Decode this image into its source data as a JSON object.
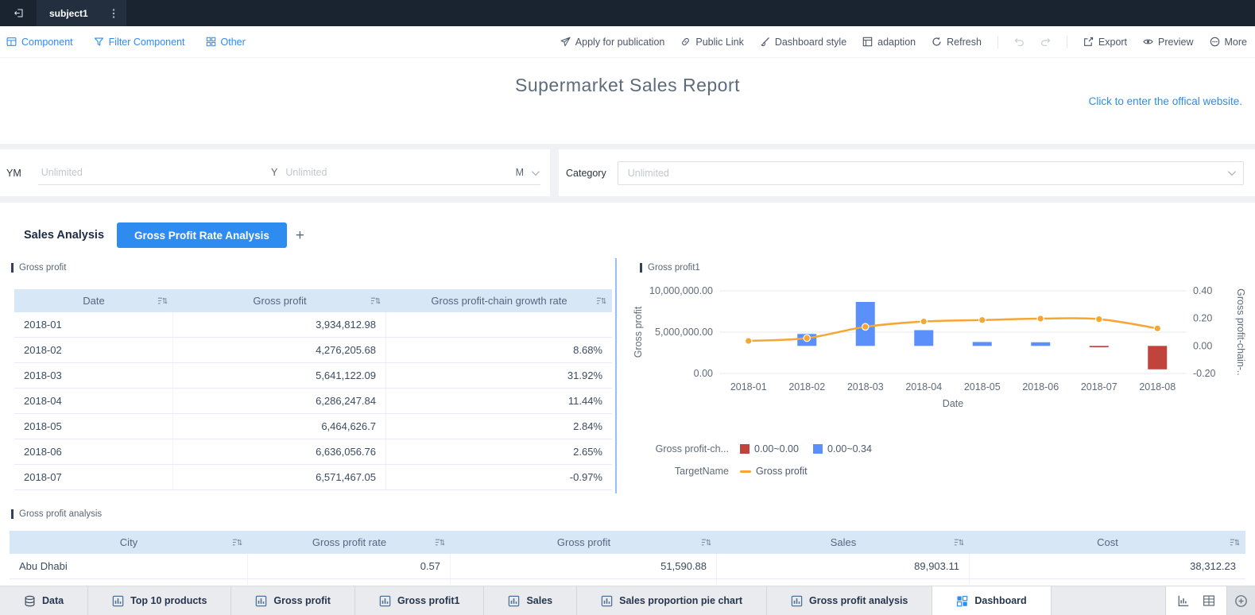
{
  "colors": {
    "accent": "#2e8cf0",
    "bar_positive": "#5b8ff9",
    "bar_negative": "#c0443c",
    "line": "#f6a632",
    "table_header_bg": "#d8e7f6",
    "topbar_bg": "#1a2330"
  },
  "topbar": {
    "tab_title": "subject1"
  },
  "toolbar": {
    "left": [
      {
        "label": "Component",
        "icon": "component"
      },
      {
        "label": "Filter Component",
        "icon": "filter"
      },
      {
        "label": "Other",
        "icon": "other"
      }
    ],
    "right": [
      {
        "type": "button",
        "label": "Apply for publication",
        "icon": "plane"
      },
      {
        "type": "button",
        "label": "Public Link",
        "icon": "link"
      },
      {
        "type": "button",
        "label": "Dashboard style",
        "icon": "style"
      },
      {
        "type": "button",
        "label": "adaption",
        "icon": "adaption"
      },
      {
        "type": "button",
        "label": "Refresh",
        "icon": "refresh"
      },
      {
        "type": "separator"
      },
      {
        "type": "icon",
        "icon": "undo",
        "disabled": true
      },
      {
        "type": "icon",
        "icon": "redo",
        "disabled": true
      },
      {
        "type": "separator"
      },
      {
        "type": "button",
        "label": "Export",
        "icon": "export"
      },
      {
        "type": "button",
        "label": "Preview",
        "icon": "preview"
      },
      {
        "type": "button",
        "label": "More",
        "icon": "more"
      }
    ]
  },
  "header": {
    "title": "Supermarket Sales Report",
    "link": "Click to enter the offical website."
  },
  "filters": {
    "ym": {
      "label": "YM",
      "start_placeholder": "Unlimited",
      "start_unit": "Y",
      "end_placeholder": "Unlimited",
      "end_unit": "M"
    },
    "category": {
      "label": "Category",
      "placeholder": "Unlimited"
    }
  },
  "tabs": {
    "inactive": "Sales Analysis",
    "active": "Gross Profit Rate Analysis",
    "add_label": "+"
  },
  "gross_profit_table": {
    "title": "Gross profit",
    "columns": [
      "Date",
      "Gross profit",
      "Gross profit-chain growth rate"
    ],
    "rows": [
      [
        "2018-01",
        "3,934,812.98",
        ""
      ],
      [
        "2018-02",
        "4,276,205.68",
        "8.68%"
      ],
      [
        "2018-03",
        "5,641,122.09",
        "31.92%"
      ],
      [
        "2018-04",
        "6,286,247.84",
        "11.44%"
      ],
      [
        "2018-05",
        "6,464,626.7",
        "2.84%"
      ],
      [
        "2018-06",
        "6,636,056.76",
        "2.65%"
      ],
      [
        "2018-07",
        "6,571,467.05",
        "-0.97%"
      ]
    ]
  },
  "chart_widget": {
    "title": "Gross profit1"
  },
  "chart_data": {
    "type": "combo-bar-line",
    "categories": [
      "2018-01",
      "2018-02",
      "2018-03",
      "2018-04",
      "2018-05",
      "2018-06",
      "2018-07",
      "2018-08"
    ],
    "series": [
      {
        "name": "Gross profit",
        "type": "line",
        "axis": "left",
        "color": "#f6a632",
        "values": [
          3934812.98,
          4276205.68,
          5641122.09,
          6286247.84,
          6464626.7,
          6636056.76,
          6571467.05,
          5450000
        ]
      },
      {
        "name": "Gross profit-chain growth rate",
        "type": "bar",
        "axis": "right",
        "values": [
          null,
          0.0868,
          0.3192,
          0.1144,
          0.0284,
          0.0265,
          -0.0097,
          -0.17
        ]
      }
    ],
    "left_axis": {
      "title": "Gross profit",
      "min": 0,
      "max": 10000000,
      "ticks": [
        {
          "value": 10000000,
          "label": "10,000,000.00"
        },
        {
          "value": 5000000,
          "label": "5,000,000.00"
        },
        {
          "value": 0,
          "label": "0.00"
        }
      ]
    },
    "right_axis": {
      "title": "Gross profit-chain-..",
      "min": -0.2,
      "max": 0.4,
      "ticks": [
        {
          "value": 0.4,
          "label": "0.40"
        },
        {
          "value": 0.2,
          "label": "0.20"
        },
        {
          "value": 0,
          "label": "0.00"
        },
        {
          "value": -0.2,
          "label": "-0.20"
        }
      ]
    },
    "xlabel": "Date",
    "grid": true,
    "legend": [
      {
        "group": "Gross profit-ch...",
        "items": [
          {
            "label": "0.00~0.00",
            "swatch": "square",
            "color": "#c0443c"
          },
          {
            "label": "0.00~0.34",
            "swatch": "square",
            "color": "#5b8ff9"
          }
        ]
      },
      {
        "group": "TargetName",
        "items": [
          {
            "label": "Gross profit",
            "swatch": "line",
            "color": "#f6a632"
          }
        ]
      }
    ]
  },
  "analysis_table": {
    "title": "Gross profit analysis",
    "columns": [
      "City",
      "Gross profit rate",
      "Gross profit",
      "Sales",
      "Cost"
    ],
    "rows": [
      [
        "Abu Dhabi",
        "0.57",
        "51,590.88",
        "89,903.11",
        "38,312.23"
      ]
    ]
  },
  "bottombar": {
    "tabs": [
      {
        "label": "Data",
        "icon": "database",
        "active": false
      },
      {
        "label": "Top 10 products",
        "icon": "chart",
        "active": false
      },
      {
        "label": "Gross profit",
        "icon": "chart",
        "active": false
      },
      {
        "label": "Gross profit1",
        "icon": "chart",
        "active": false
      },
      {
        "label": "Sales",
        "icon": "chart",
        "active": false
      },
      {
        "label": "Sales proportion pie chart",
        "icon": "chart",
        "active": false
      },
      {
        "label": "Gross profit analysis",
        "icon": "chart",
        "active": false
      },
      {
        "label": "Dashboard",
        "icon": "dashboard",
        "active": true
      }
    ],
    "actions": [
      {
        "icon": "chart-add"
      },
      {
        "icon": "table-add"
      }
    ],
    "corner_icon": "corner"
  }
}
